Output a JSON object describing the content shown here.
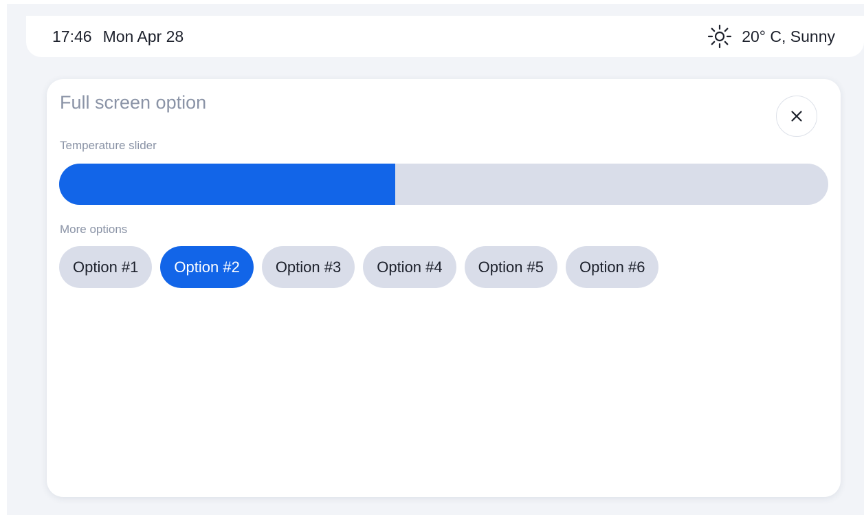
{
  "status_bar": {
    "time": "17:46",
    "date": "Mon Apr 28",
    "weather_icon": "sun-icon",
    "weather": "20° C, Sunny"
  },
  "panel": {
    "title": "Full screen option",
    "close_icon": "close-icon",
    "slider": {
      "label": "Temperature slider",
      "value_fraction": 0.437,
      "fill_color": "#1265e8",
      "track_color": "#d9dde9"
    },
    "options": {
      "label": "More options",
      "items": [
        {
          "label": "Option #1",
          "selected": false
        },
        {
          "label": "Option #2",
          "selected": true
        },
        {
          "label": "Option #3",
          "selected": false
        },
        {
          "label": "Option #4",
          "selected": false
        },
        {
          "label": "Option #5",
          "selected": false
        },
        {
          "label": "Option #6",
          "selected": false
        }
      ]
    }
  },
  "colors": {
    "accent": "#1265e8",
    "chip_background": "#d9dde9",
    "muted_text": "#8a93a6",
    "text": "#1b1f2a"
  }
}
